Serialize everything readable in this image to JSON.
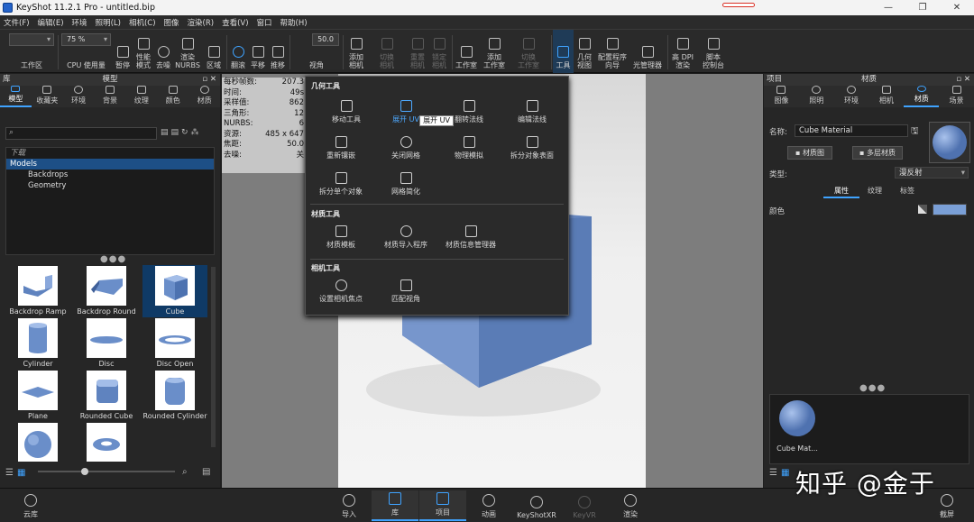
{
  "window": {
    "title": "KeyShot 11.2.1 Pro  - untitled.bip",
    "controls": [
      "—",
      "❐",
      "✕"
    ]
  },
  "menu": [
    "文件(F)",
    "编辑(E)",
    "环境",
    "照明(L)",
    "相机(C)",
    "图像",
    "渲染(R)",
    "查看(V)",
    "窗口",
    "帮助(H)"
  ],
  "toolbar": {
    "workspace_label": "工作区",
    "cpu_label": "CPU 使用量",
    "cpu_value": "75 %",
    "pause_label": "暂停",
    "perf_label": "性能\n模式",
    "denoise_label": "去噪",
    "render_nurbs_label": "渲染\nNURBS",
    "region_label": "区域",
    "rotate_label": "翻滚",
    "pan_label": "平移",
    "push_label": "推移",
    "fov_value": "50.0",
    "view_label": "视角",
    "add_camera_label": "添加\n相机",
    "switch_camera_label": "切换\n相机",
    "reset_camera_label": "重置\n相机",
    "lock_camera_label": "锁定\n相机",
    "studio_label": "工作室",
    "add_studio_label": "添加\n工作室",
    "switch_studio_label": "切换\n工作室",
    "tools_label": "工具",
    "geometry_view_label": "几何\n视图",
    "config_wizard_label": "配置程序\n向导",
    "light_manager_label": "光管理器",
    "hidpi_label": "高 DPI\n渲染",
    "script_label": "脚本\n控制台"
  },
  "library": {
    "title": "模型",
    "tab_panel_label": "库",
    "tabs": [
      "模型",
      "收藏夹",
      "环境",
      "背景",
      "纹理",
      "颜色",
      "材质"
    ],
    "tree": [
      "下载",
      "Models",
      "Backdrops",
      "Geometry"
    ],
    "thumbs": [
      "Backdrop Ramp",
      "Backdrop Round",
      "Cube",
      "Cylinder",
      "Disc",
      "Disc Open",
      "Plane",
      "Rounded Cube",
      "Rounded Cylinder",
      "",
      ""
    ]
  },
  "stats": [
    {
      "k": "每秒帧数:",
      "v": "207.3"
    },
    {
      "k": "时间:",
      "v": "49s"
    },
    {
      "k": "采样值:",
      "v": "862"
    },
    {
      "k": "三角形:",
      "v": "12"
    },
    {
      "k": "NURBS:",
      "v": "6"
    },
    {
      "k": "资源:",
      "v": "485 x 647"
    },
    {
      "k": "焦距:",
      "v": "50.0"
    },
    {
      "k": "去噪:",
      "v": "关"
    }
  ],
  "tools_popup": {
    "geometry_section": "几何工具",
    "geometry_items": [
      "移动工具",
      "展开 UV",
      "翻转法线",
      "编辑法线",
      "重新镶嵌",
      "关闭网格",
      "物理模拟",
      "拆分对象表面",
      "拆分单个对象",
      "网格简化"
    ],
    "material_section": "材质工具",
    "material_items": [
      "材质模板",
      "材质导入程序",
      "材质信息管理器"
    ],
    "camera_section": "相机工具",
    "camera_items": [
      "设置相机焦点",
      "匹配视角"
    ],
    "tooltip": "展开 UV"
  },
  "project": {
    "panel_label": "项目",
    "title": "材质",
    "tabs": [
      "图像",
      "照明",
      "环境",
      "相机",
      "材质",
      "场景"
    ],
    "name_label": "名称:",
    "name_value": "Cube Material",
    "material_graph_btn": "材质图",
    "multilayer_btn": "多层材质",
    "type_label": "类型:",
    "type_value": "漫反射",
    "subtabs": [
      "属性",
      "纹理",
      "标签"
    ],
    "color_label": "颜色",
    "color_hex": "#7a9fd6",
    "thumb_label": "Cube Mat..."
  },
  "bottom": {
    "cloud": "云库",
    "items": [
      "导入",
      "库",
      "项目",
      "动画",
      "KeyShotXR",
      "KeyVR",
      "渲染"
    ],
    "screenshot": "截屏"
  },
  "watermark": "知乎 @金于",
  "colors": {
    "accent": "#3fa3ff",
    "selection": "#1d4f86",
    "cube": "#6f93cf"
  }
}
